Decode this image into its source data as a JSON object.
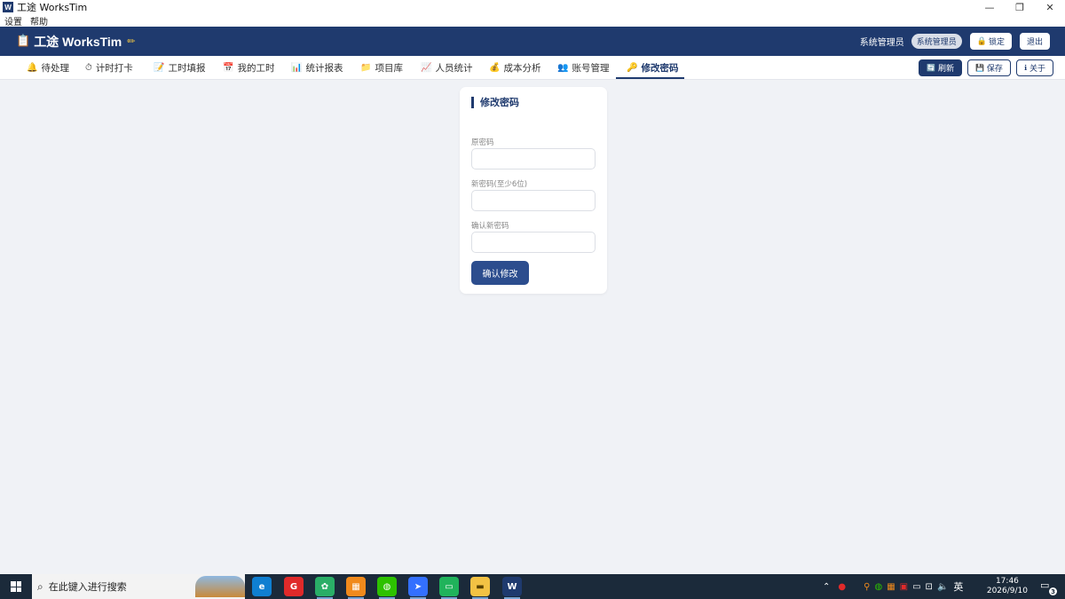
{
  "window": {
    "title": "工途 WorksTim",
    "app_icon_letter": "W",
    "minimize": "—",
    "restore": "❐",
    "close": "✕"
  },
  "menu": {
    "items": [
      "设置",
      "帮助"
    ]
  },
  "header": {
    "brand": "工途 WorksTim",
    "user_name": "系统管理员",
    "role_badge": "系统管理员",
    "lock_label": "锁定",
    "logout_label": "退出",
    "bg_color": "#1f3a6e"
  },
  "tabs": [
    {
      "label": "待处理",
      "icon": "bell-icon",
      "glyph": "🔔"
    },
    {
      "label": "计时打卡",
      "icon": "stopwatch-icon",
      "glyph": "⏱"
    },
    {
      "label": "工时填报",
      "icon": "memo-icon",
      "glyph": "📝"
    },
    {
      "label": "我的工时",
      "icon": "calendar-icon",
      "glyph": "📅"
    },
    {
      "label": "统计报表",
      "icon": "bar-chart-icon",
      "glyph": "📊"
    },
    {
      "label": "项目库",
      "icon": "folder-icon",
      "glyph": "📁"
    },
    {
      "label": "人员统计",
      "icon": "chart-up-icon",
      "glyph": "📈"
    },
    {
      "label": "成本分析",
      "icon": "money-bag-icon",
      "glyph": "💰"
    },
    {
      "label": "账号管理",
      "icon": "users-icon",
      "glyph": "👥"
    },
    {
      "label": "修改密码",
      "icon": "key-icon",
      "glyph": "🔑"
    }
  ],
  "active_tab": "修改密码",
  "toolbar": {
    "refresh_label": "刷新",
    "save_label": "保存",
    "about_label": "关于"
  },
  "form": {
    "title": "修改密码",
    "old_password_label": "原密码",
    "old_password_value": "",
    "new_password_label": "新密码(至少6位)",
    "new_password_value": "",
    "confirm_password_label": "确认新密码",
    "confirm_password_value": "",
    "submit_label": "确认修改"
  },
  "taskbar": {
    "search_placeholder": "在此键入进行搜索",
    "ime_label": "英",
    "time": "17:46",
    "date": "2026/9/10",
    "notification_count": "3",
    "apps": [
      {
        "name": "edge-icon",
        "color": "#0f7fd1",
        "glyph": "e"
      },
      {
        "name": "wps-icon",
        "color": "#e02a2a",
        "glyph": "G"
      },
      {
        "name": "wechat-work-icon",
        "color": "#2aae67",
        "glyph": "✿"
      },
      {
        "name": "orange-app-icon",
        "color": "#f08a1c",
        "glyph": "▦"
      },
      {
        "name": "wechat-icon",
        "color": "#2dc100",
        "glyph": "◍"
      },
      {
        "name": "feishu-icon",
        "color": "#3370ff",
        "glyph": "➤"
      },
      {
        "name": "chat-icon",
        "color": "#20b35b",
        "glyph": "▭"
      },
      {
        "name": "file-explorer-icon",
        "color": "#f3c244",
        "glyph": "▬"
      },
      {
        "name": "workstim-icon",
        "color": "#1f3a6e",
        "glyph": "W"
      }
    ]
  }
}
